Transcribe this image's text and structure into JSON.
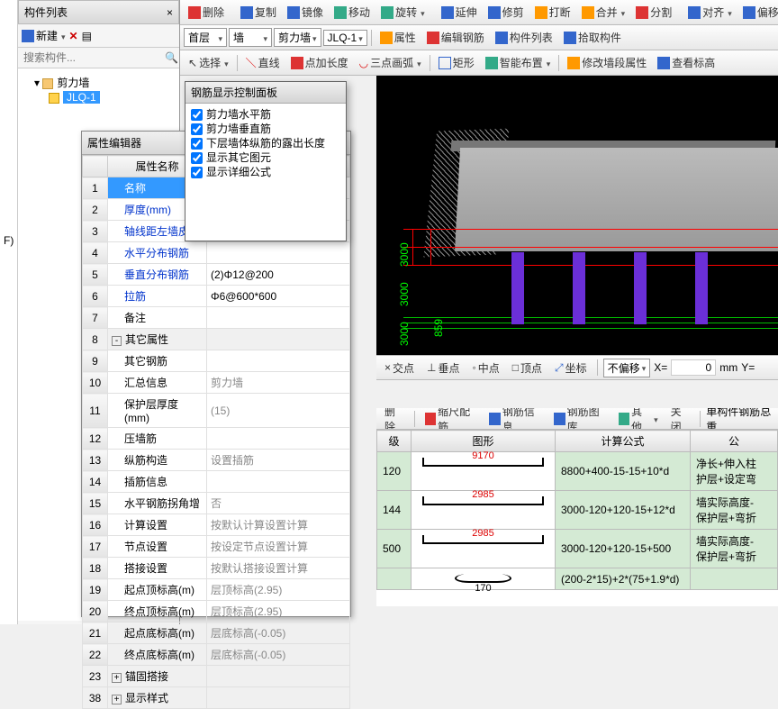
{
  "left_strip": {
    "fkey": "F)"
  },
  "component_panel": {
    "title": "构件列表",
    "new_btn": "新建",
    "search_placeholder": "搜索构件...",
    "tree_root": "剪力墙",
    "tree_item": "JLQ-1"
  },
  "toolbar1": {
    "delete": "删除",
    "copy": "复制",
    "mirror": "镜像",
    "move": "移动",
    "rotate": "旋转",
    "extend": "延伸",
    "trim": "修剪",
    "break": "打断",
    "join": "合并",
    "split": "分割",
    "align": "对齐",
    "offset": "偏移"
  },
  "toolbar2": {
    "floor": "首层",
    "cat": "墙",
    "subcat": "剪力墙",
    "item": "JLQ-1",
    "attr": "属性",
    "edit_rebar": "编辑钢筋",
    "list": "构件列表",
    "pick": "拾取构件"
  },
  "toolbar3": {
    "select": "选择",
    "line": "直线",
    "point_len": "点加长度",
    "arc": "三点画弧",
    "rect": "矩形",
    "smart": "智能布置",
    "wall_attr": "修改墙段属性",
    "view_lbl": "查看标高"
  },
  "rebar_dialog": {
    "title": "钢筋显示控制面板",
    "items": [
      "剪力墙水平筋",
      "剪力墙垂直筋",
      "下层墙体纵筋的露出长度",
      "显示其它图元",
      "显示详细公式"
    ]
  },
  "viewport": {
    "axis": [
      "3000",
      "3000",
      "3000"
    ],
    "dim2": "859"
  },
  "snap_bar": {
    "jd": "交点",
    "cd": "垂点",
    "zd": "中点",
    "dd": "顶点",
    "zb": "坐标",
    "offset": "不偏移",
    "x": "X=",
    "xv": "0",
    "unit": "mm",
    "y": "Y="
  },
  "prop_panel": {
    "title": "属性编辑器",
    "col_name": "属性名称",
    "rows": [
      {
        "n": "1",
        "name": "名称",
        "val": "",
        "link": false,
        "sel": true
      },
      {
        "n": "2",
        "name": "厚度(mm)",
        "val": "",
        "link": true
      },
      {
        "n": "3",
        "name": "轴线距左墙皮",
        "val": "",
        "link": true
      },
      {
        "n": "4",
        "name": "水平分布钢筋",
        "val": "",
        "link": true
      },
      {
        "n": "5",
        "name": "垂直分布钢筋",
        "val": "(2)Φ12@200",
        "link": true
      },
      {
        "n": "6",
        "name": "拉筋",
        "val": "Φ6@600*600",
        "link": true
      },
      {
        "n": "7",
        "name": "备注",
        "val": ""
      },
      {
        "n": "8",
        "name": "其它属性",
        "val": "",
        "group": true,
        "exp": "-"
      },
      {
        "n": "9",
        "name": "其它钢筋",
        "val": ""
      },
      {
        "n": "10",
        "name": "汇总信息",
        "val": "剪力墙",
        "dim": true
      },
      {
        "n": "11",
        "name": "保护层厚度(mm)",
        "val": "(15)",
        "dim": true
      },
      {
        "n": "12",
        "name": "压墙筋",
        "val": ""
      },
      {
        "n": "13",
        "name": "纵筋构造",
        "val": "设置插筋",
        "dim": true
      },
      {
        "n": "14",
        "name": "插筋信息",
        "val": ""
      },
      {
        "n": "15",
        "name": "水平钢筋拐角增",
        "val": "否",
        "dim": true
      },
      {
        "n": "16",
        "name": "计算设置",
        "val": "按默认计算设置计算",
        "dim": true
      },
      {
        "n": "17",
        "name": "节点设置",
        "val": "按设定节点设置计算",
        "dim": true
      },
      {
        "n": "18",
        "name": "搭接设置",
        "val": "按默认搭接设置计算",
        "dim": true
      },
      {
        "n": "19",
        "name": "起点顶标高(m)",
        "val": "层顶标高(2.95)",
        "dim": true
      },
      {
        "n": "20",
        "name": "终点顶标高(m)",
        "val": "层顶标高(2.95)",
        "dim": true
      },
      {
        "n": "21",
        "name": "起点底标高(m)",
        "val": "层底标高(-0.05)",
        "dim": true
      },
      {
        "n": "22",
        "name": "终点底标高(m)",
        "val": "层底标高(-0.05)",
        "dim": true
      },
      {
        "n": "23",
        "name": "锚固搭接",
        "val": "",
        "group": true,
        "exp": "+"
      },
      {
        "n": "38",
        "name": "显示样式",
        "val": "",
        "group": true,
        "exp": "+"
      }
    ]
  },
  "result_bar": {
    "delete": "删除",
    "scale": "缩尺配筋",
    "info": "钢筋信息",
    "lib": "钢筋图库",
    "other": "其他",
    "close": "关闭",
    "single": "单构件钢筋总重"
  },
  "result_table": {
    "h_level": "级",
    "h_shape": "图形",
    "h_formula": "计算公式",
    "h_desc": "公",
    "rows": [
      {
        "lvl": "120",
        "shape": "9170",
        "formula": "8800+400-15-15+10*d",
        "desc": "净长+伸入柱\n护层+设定弯"
      },
      {
        "lvl": "144",
        "shape": "2985",
        "formula": "3000-120+120-15+12*d",
        "desc": "墙实际高度-\n保护层+弯折"
      },
      {
        "lvl": "500",
        "shape": "2985",
        "formula": "3000-120+120-15+500",
        "desc": "墙实际高度-\n保护层+弯折"
      },
      {
        "lvl": "",
        "shape": "170",
        "oval": true,
        "formula": "(200-2*15)+2*(75+1.9*d)",
        "desc": ""
      }
    ]
  }
}
